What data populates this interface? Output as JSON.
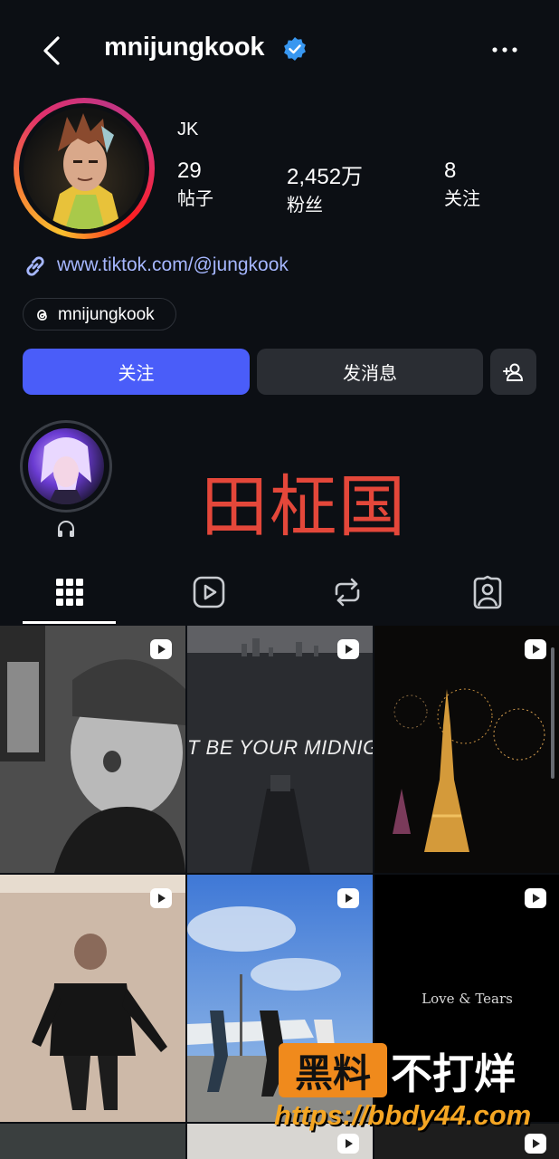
{
  "header": {
    "username": "mnijungkook"
  },
  "profile": {
    "display_name": "JK",
    "stats": [
      {
        "value": "29",
        "label": "帖子"
      },
      {
        "value": "2,452万",
        "label": "粉丝"
      },
      {
        "value": "8",
        "label": "关注"
      }
    ],
    "link": "www.tiktok.com/@jungkook",
    "threads_handle": "mnijungkook"
  },
  "actions": {
    "follow": "关注",
    "message": "发消息"
  },
  "overlay_text": "田柾国",
  "tabs": [
    "grid-icon",
    "reels-icon",
    "reposts-icon",
    "tagged-icon"
  ],
  "posts": [
    {
      "type": "reel"
    },
    {
      "type": "reel",
      "caption": "T BE YOUR MIDNIGHT"
    },
    {
      "type": "reel"
    },
    {
      "type": "reel"
    },
    {
      "type": "reel"
    },
    {
      "type": "reel",
      "caption": "Love & Tears"
    }
  ],
  "watermark": {
    "brand": "黑料",
    "slogan": "不打烊",
    "url": "https://bbdy44.com"
  },
  "colors": {
    "background": "#0c0f14",
    "accent": "#4a5df9",
    "link": "#a6b7ff",
    "verified": "#3897f0"
  }
}
